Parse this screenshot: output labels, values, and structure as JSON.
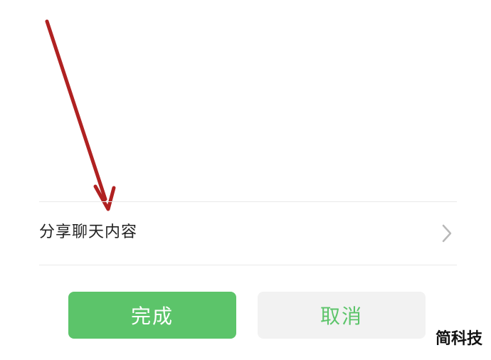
{
  "share_row": {
    "label": "分享聊天内容",
    "chevron_icon": "chevron-right-icon"
  },
  "buttons": {
    "done_label": "完成",
    "cancel_label": "取消"
  },
  "watermark": {
    "text": "简科技"
  },
  "colors": {
    "accent_green": "#5cc46a",
    "cancel_bg": "#f2f2f2",
    "arrow_red": "#b02121"
  },
  "annotation": {
    "icon": "red-arrow-icon"
  }
}
